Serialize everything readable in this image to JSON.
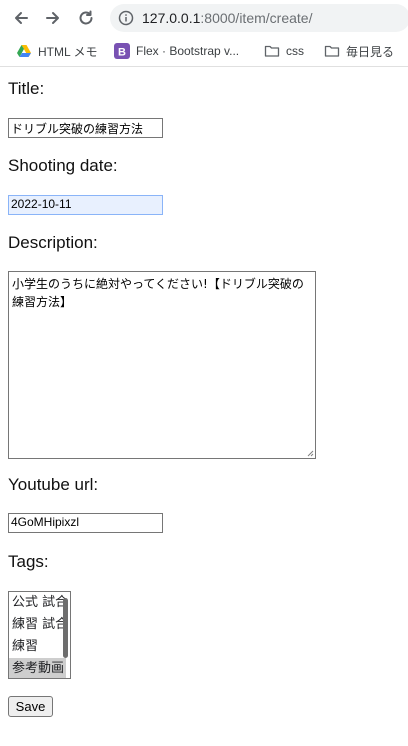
{
  "browser": {
    "url_host": "127.0.0.1",
    "url_rest": ":8000/item/create/",
    "bookmarks": [
      {
        "label": "HTML メモ",
        "icon": "google-drive-icon"
      },
      {
        "label": "Flex · Bootstrap v...",
        "icon": "bootstrap-icon"
      },
      {
        "label": "css",
        "icon": "folder-icon"
      },
      {
        "label": "毎日見る",
        "icon": "folder-icon"
      }
    ]
  },
  "form": {
    "title_label": "Title:",
    "title_value": "ドリブル突破の練習方法",
    "shooting_date_label": "Shooting date:",
    "shooting_date_value": "2022-10-11",
    "description_label": "Description:",
    "description_value": "小学生のうちに絶対やってください!【ドリブル突破の練習方法】",
    "youtube_url_label": "Youtube url:",
    "youtube_url_value": "4GoMHipixzl",
    "tags_label": "Tags:",
    "tags_options": [
      "公式 試合",
      "練習 試合",
      "練習",
      "参考動画"
    ],
    "save_label": "Save"
  },
  "colors": {
    "date_autofill_bg": "#e8f0fe",
    "selected_option_bg": "#cecece",
    "bootstrap_purple": "#7952b3"
  }
}
